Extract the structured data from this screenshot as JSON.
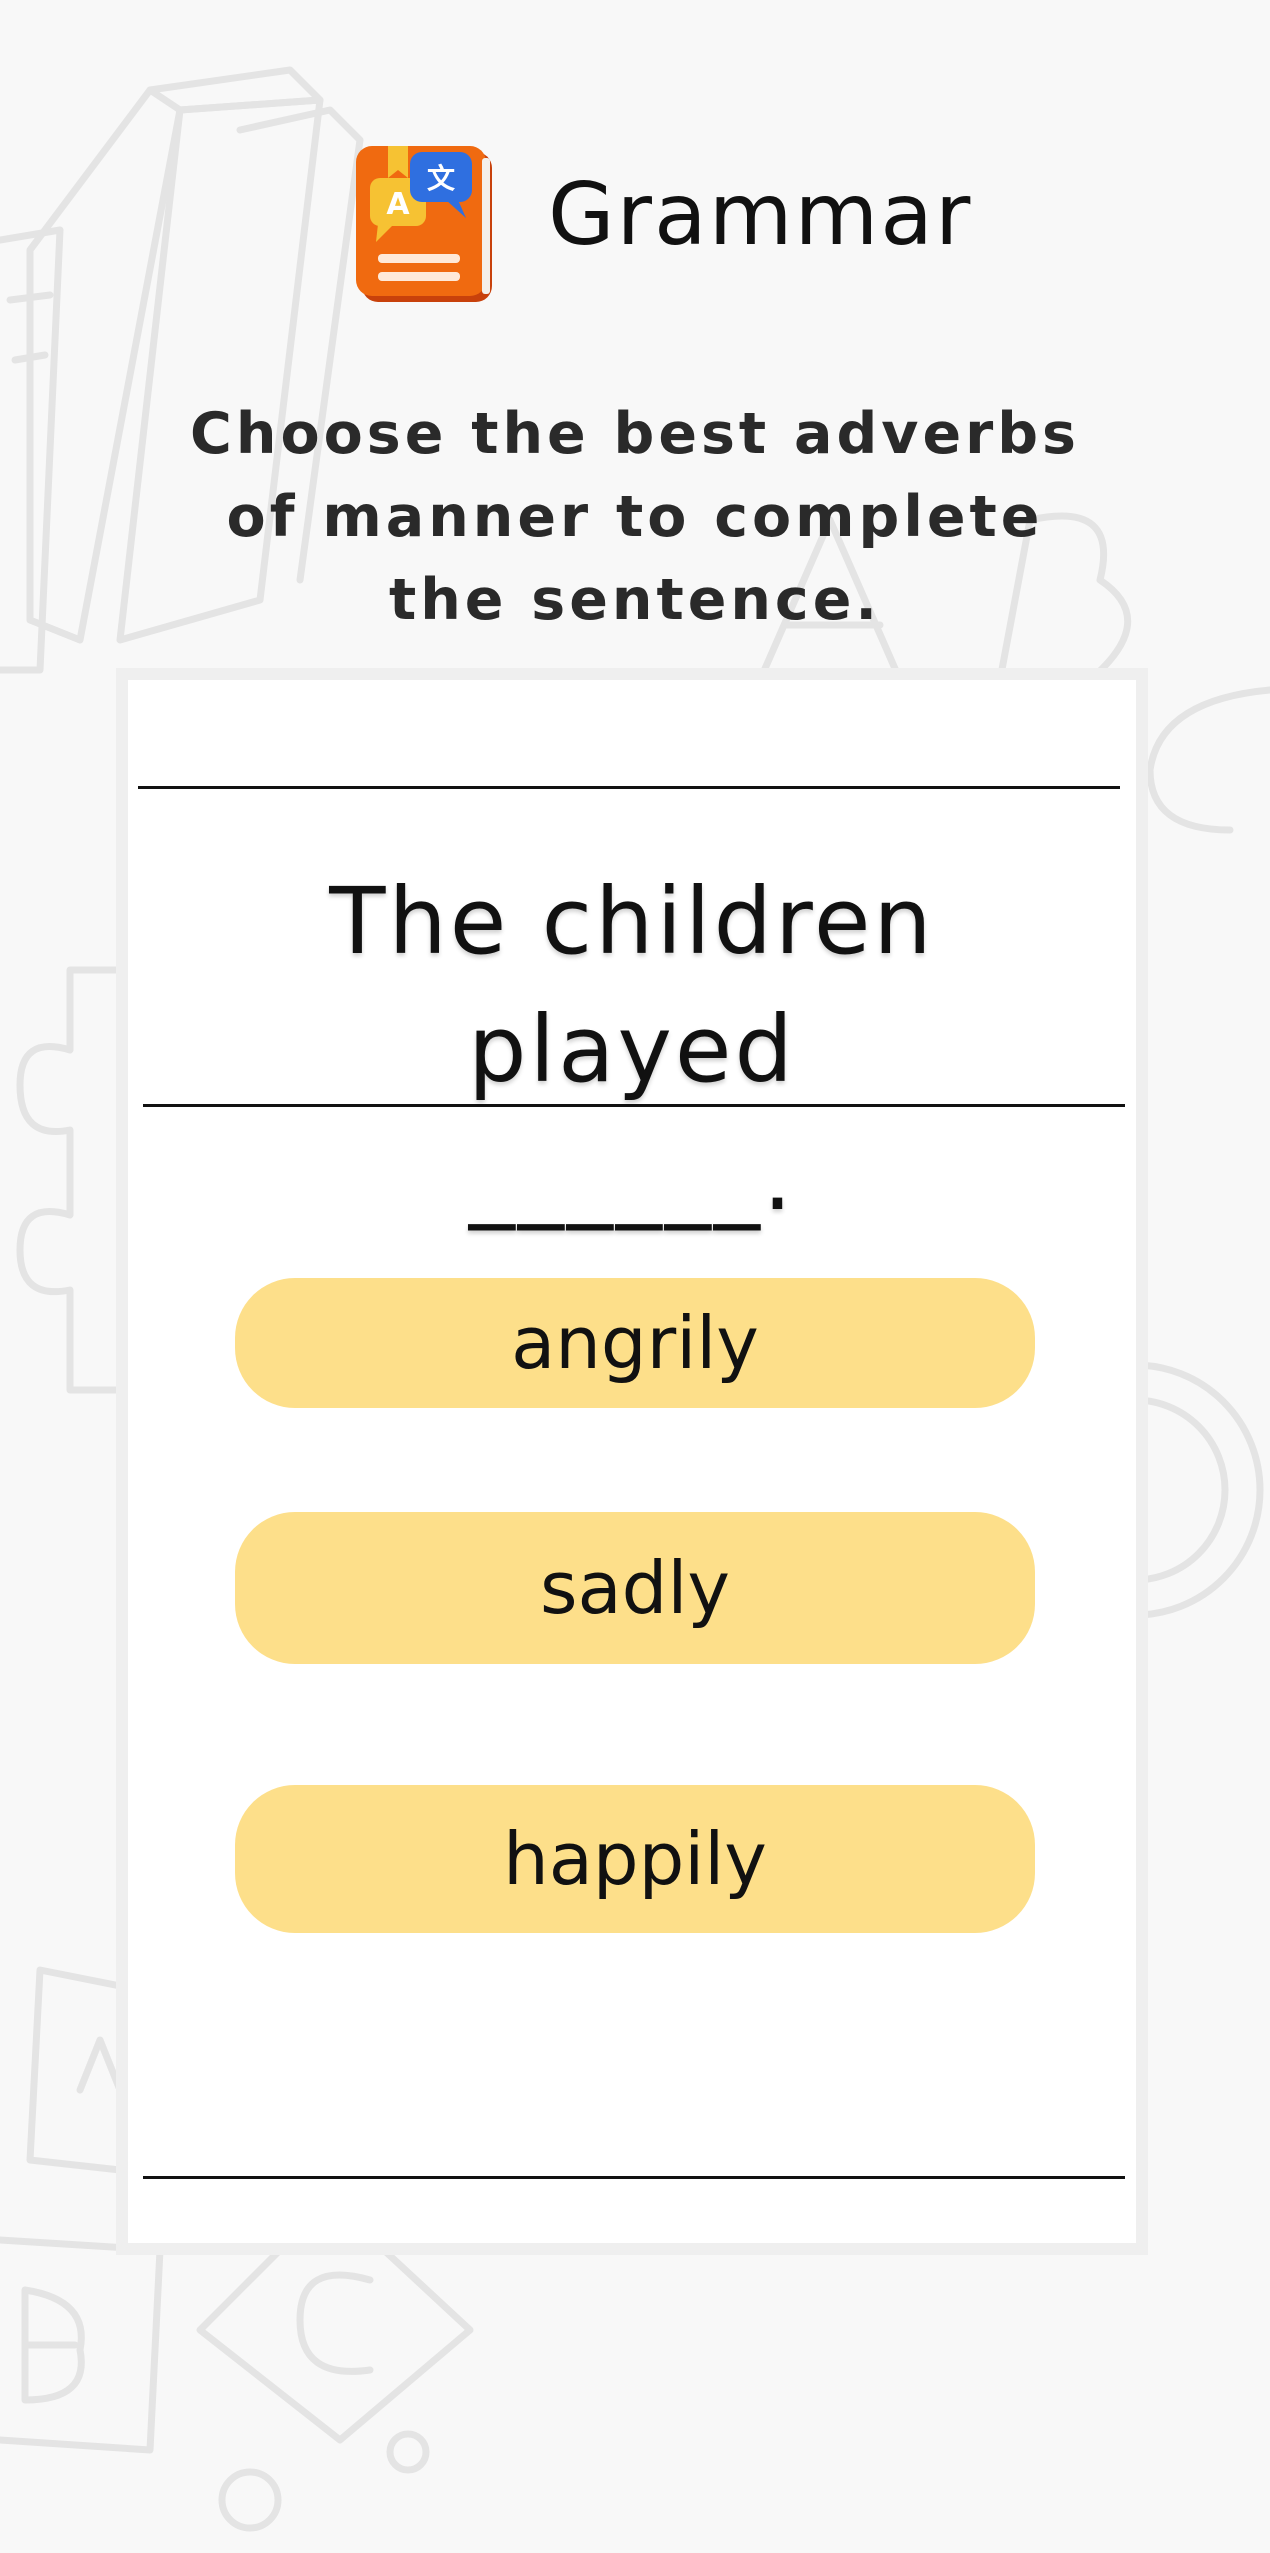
{
  "header": {
    "title": "Grammar",
    "icon": "grammar-book-icon"
  },
  "instruction": "Choose the best adverbs of manner to complete the sentence.",
  "question": {
    "line1": "The children played",
    "line2": "______."
  },
  "options": [
    {
      "label": "angrily"
    },
    {
      "label": "sadly"
    },
    {
      "label": "happily"
    }
  ],
  "colors": {
    "background": "#f8f8f8",
    "card": "#ffffff",
    "option_fill": "#fddf8a",
    "icon_book": "#f06a10",
    "icon_bubble": "#2f6fe0",
    "icon_bubble_alt": "#f6c233",
    "doodle_stroke": "#e4e4e4"
  }
}
